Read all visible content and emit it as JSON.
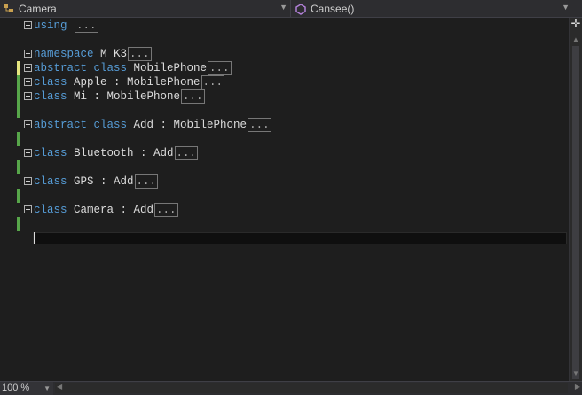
{
  "navbar": {
    "type_label": "Camera",
    "member_label": "Cansee()"
  },
  "code_lines": [
    {
      "kw": "using",
      "text": " ",
      "has_mark": false
    },
    {
      "kw": "namespace",
      "text": " M_K3",
      "has_mark": true
    },
    {
      "kw": "abstract class",
      "text": " MobilePhone",
      "has_mark": true
    },
    {
      "kw": "class",
      "text": " Apple : MobilePhone",
      "has_mark": true
    },
    {
      "kw": "class",
      "text": " Mi : MobilePhone",
      "has_mark": true
    },
    {
      "kw": "abstract class",
      "text": " Add : MobilePhone",
      "has_mark": true
    },
    {
      "kw": "class",
      "text": " Bluetooth : Add",
      "has_mark": true
    },
    {
      "kw": "class",
      "text": " GPS : Add",
      "has_mark": true
    },
    {
      "kw": "class",
      "text": " Camera : Add",
      "has_mark": true
    }
  ],
  "collapsed_text": "...",
  "statusbar": {
    "zoom": "100 %"
  },
  "colors": {
    "keyword": "#569cd6",
    "mark_saved": "#57a64a",
    "mark_unsaved": "#e6e680",
    "background": "#1e1e1e"
  }
}
